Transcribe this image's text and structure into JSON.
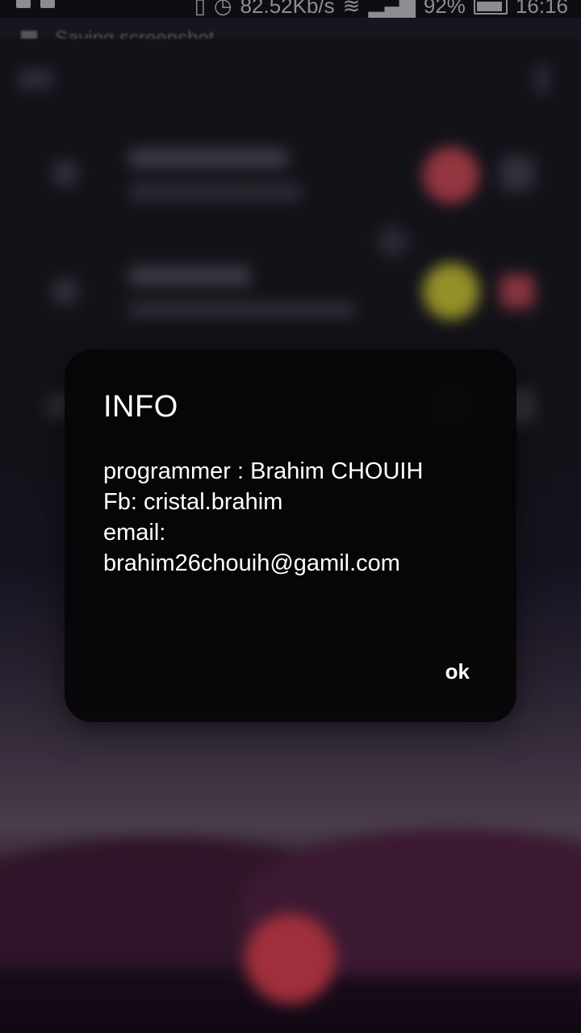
{
  "status_bar": {
    "speed": "82.52Kb/s",
    "battery": "92%",
    "time": "16:16"
  },
  "notification": {
    "text": "Saving screenshot"
  },
  "dialog": {
    "title": "INFO",
    "lines": [
      "programmer : Brahim CHOUIH",
      "Fb: cristal.brahim",
      "email:",
      "brahim26chouih@gamil.com"
    ],
    "ok_label": "ok"
  },
  "colors": {
    "dialog_bg": "#060608",
    "text": "#ffffff"
  }
}
